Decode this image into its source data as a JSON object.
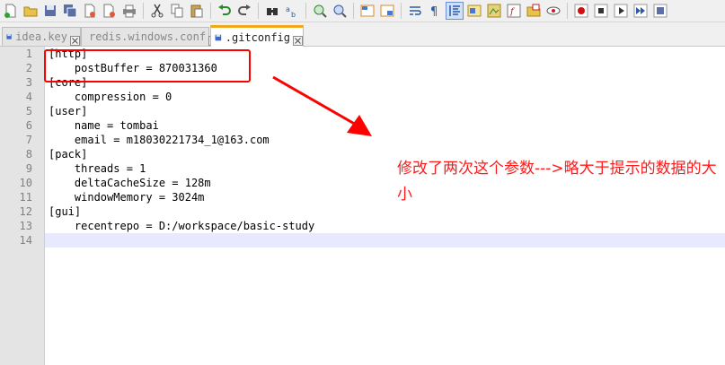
{
  "toolbar": {
    "icons": [
      "new-file-icon",
      "open-file-icon",
      "save-icon",
      "save-all-icon",
      "close-icon",
      "close-all-icon",
      "print-icon",
      "cut-icon",
      "copy-icon",
      "paste-icon",
      "undo-icon",
      "redo-icon",
      "find-icon",
      "replace-icon",
      "zoom-in-icon",
      "zoom-out-icon",
      "sync-vertical-icon",
      "sync-horizontal-icon",
      "word-wrap-icon",
      "show-all-chars-icon",
      "indent-guide-icon",
      "user-defined-language-icon",
      "document-map-icon",
      "function-list-icon",
      "folder-workspace-icon",
      "monitoring-icon",
      "record-macro-icon",
      "stop-record-icon",
      "playback-macro-icon",
      "run-macro-multiple-icon",
      "save-macro-icon"
    ]
  },
  "tabs": [
    {
      "label": "idea.key",
      "active": false,
      "close_glyph": "⊠"
    },
    {
      "label": "redis.windows.conf",
      "active": false,
      "close_glyph": "⊠"
    },
    {
      "label": ".gitconfig",
      "active": true,
      "close_glyph": "⊠"
    }
  ],
  "editor": {
    "line_numbers": [
      "1",
      "2",
      "3",
      "4",
      "5",
      "6",
      "7",
      "8",
      "9",
      "10",
      "11",
      "12",
      "13",
      "14"
    ],
    "lines": [
      "[http]",
      "    postBuffer = 870031360",
      "[core]",
      "    compression = 0",
      "[user]",
      "    name = tombai",
      "    email = m18030221734_1@163.com",
      "[pack]",
      "    threads = 1",
      "    deltaCacheSize = 128m",
      "    windowMemory = 3024m",
      "[gui]",
      "    recentrepo = D:/workspace/basic-study",
      ""
    ],
    "current_line": 14
  },
  "annotation": {
    "text": "修改了两次这个参数--->略大于提示的数据的大小",
    "color": "#ff1a1a"
  },
  "colors": {
    "active_tab_accent": "#f0a71a",
    "highlight": "#ff0000",
    "current_line_bg": "#e8e8ff"
  }
}
